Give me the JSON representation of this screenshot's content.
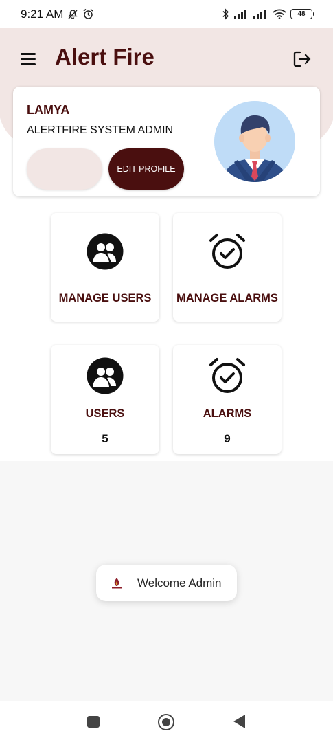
{
  "status_bar": {
    "time": "9:21 AM",
    "battery": "48",
    "icons": [
      "mute-bell-icon",
      "alarm-clock-icon",
      "bluetooth-icon",
      "signal-icon",
      "signal-icon",
      "wifi-icon",
      "battery-icon"
    ]
  },
  "app": {
    "title": "Alert Fire",
    "menu_icon": "hamburger-menu-icon",
    "logout_icon": "logout-icon",
    "brand_color": "#4a0f0f",
    "header_bg": "#f2e6e4"
  },
  "profile": {
    "name": "LAMYA",
    "role": "ALERTFIRE SYSTEM ADMIN",
    "edit_button": "EDIT PROFILE",
    "avatar_icon": "businessman-avatar"
  },
  "tiles": {
    "manage_users": {
      "label": "MANAGE USERS",
      "icon": "users-group-icon"
    },
    "manage_alarms": {
      "label": "MANAGE ALARMS",
      "icon": "alarm-check-icon"
    },
    "users": {
      "label": "USERS",
      "count": "5",
      "icon": "users-group-icon"
    },
    "alarms": {
      "label": "ALARMS",
      "count": "9",
      "icon": "alarm-check-icon"
    }
  },
  "toast": {
    "text": "Welcome Admin",
    "icon": "app-logo-icon"
  },
  "navbar": {
    "recents": "square-icon",
    "home": "circle-home-icon",
    "back": "back-triangle-icon"
  }
}
